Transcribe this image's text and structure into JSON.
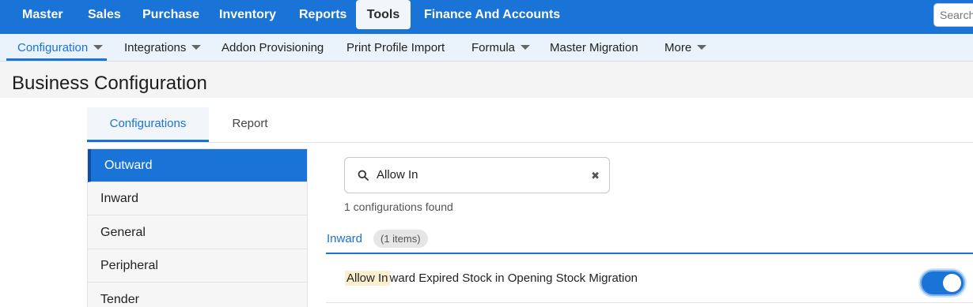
{
  "topnav": {
    "items": [
      "Master",
      "Sales",
      "Purchase",
      "Inventory",
      "Reports",
      "Tools",
      "Finance And Accounts"
    ],
    "active": "Tools",
    "search_placeholder": "Search"
  },
  "subnav": {
    "items": [
      "Configuration",
      "Integrations",
      "Addon Provisioning",
      "Print Profile Import",
      "Formula",
      "Master Migration",
      "More"
    ],
    "active": "Configuration"
  },
  "page": {
    "title": "Business Configuration"
  },
  "tabs": {
    "configurations": "Configurations",
    "report": "Report"
  },
  "leftmenu": {
    "items": [
      "Outward",
      "Inward",
      "General",
      "Peripheral",
      "Tender"
    ],
    "active": "Outward"
  },
  "search": {
    "value": "Allow In",
    "clear_icon": "close-icon",
    "icon": "search-icon"
  },
  "results": {
    "found_text": "1 configurations found",
    "group_label": "Inward",
    "group_count": "(1 items)",
    "row": {
      "highlight": "Allow In",
      "rest": "ward Expired Stock in Opening Stock Migration",
      "enabled": true
    }
  },
  "colors": {
    "accent": "#1a73d6",
    "highlight": "#fcefcf"
  }
}
